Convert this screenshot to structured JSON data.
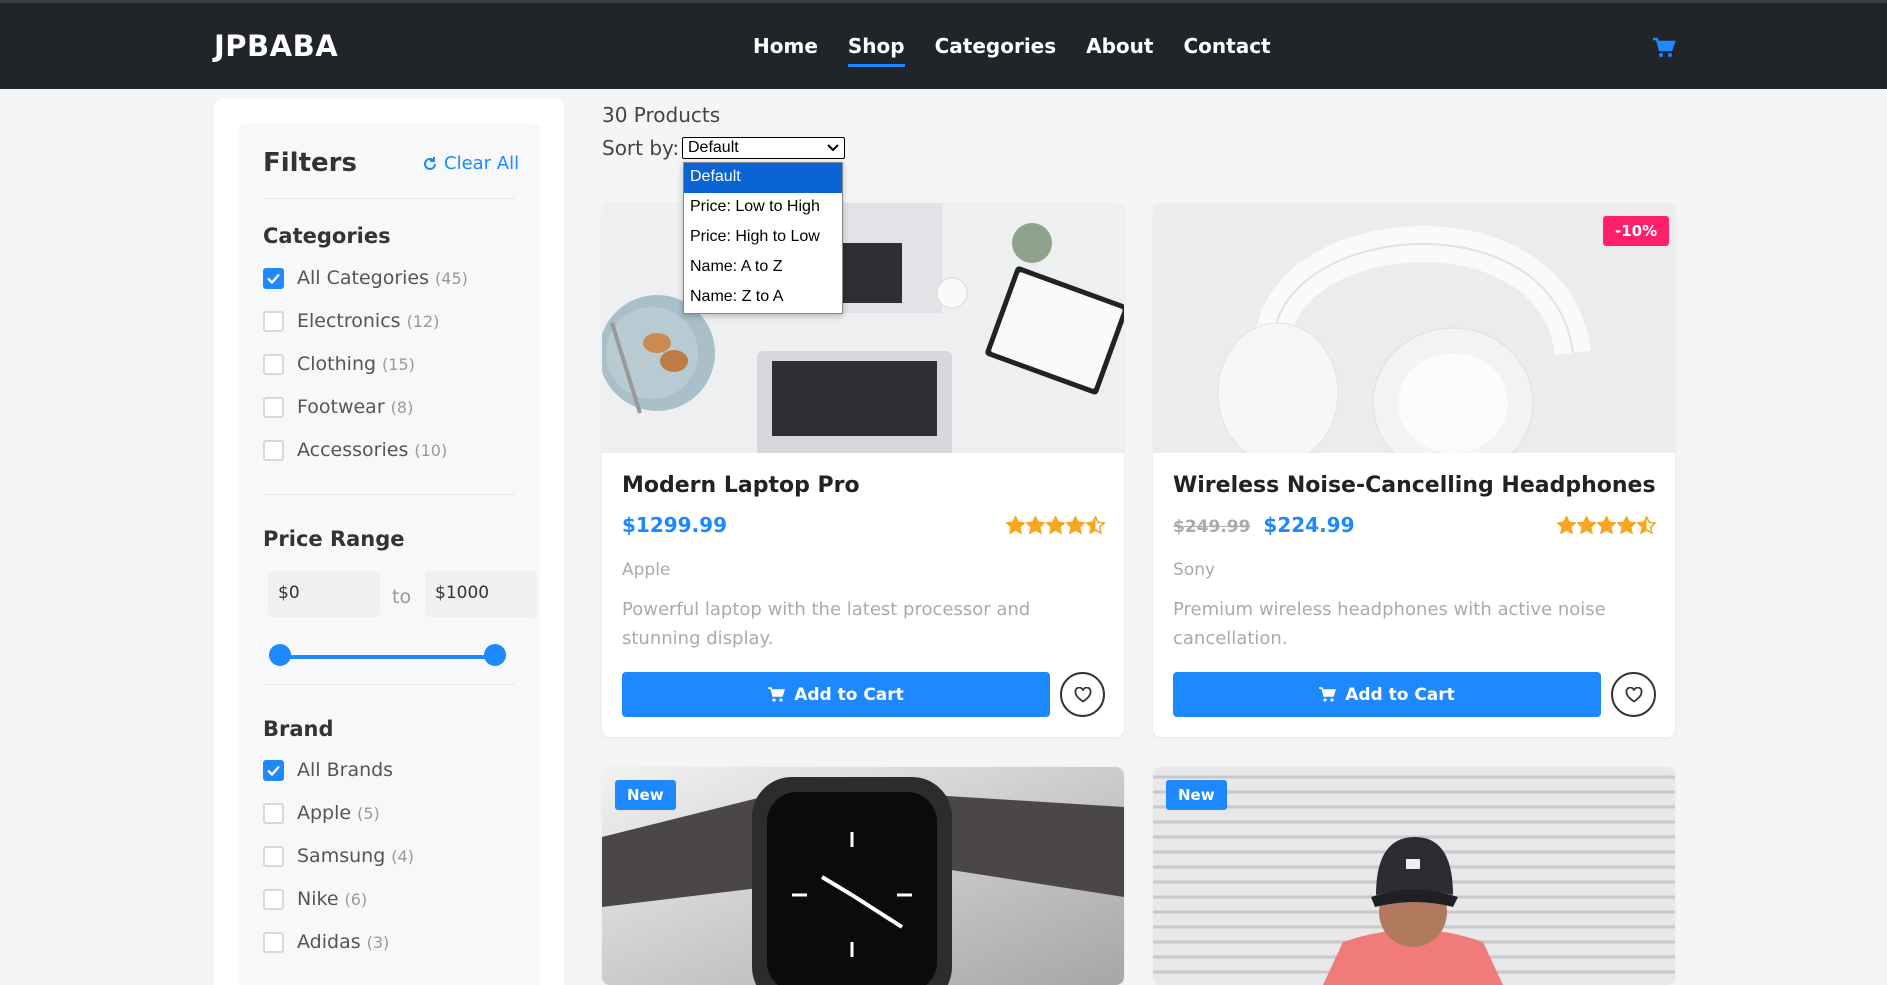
{
  "navbar": {
    "brand": "JPBABA",
    "links": [
      "Home",
      "Shop",
      "Categories",
      "About",
      "Contact"
    ],
    "active": "Shop",
    "cart_icon": "cart-icon"
  },
  "filters": {
    "title": "Filters",
    "clear_all": "Clear All",
    "categories": {
      "title": "Categories",
      "items": [
        {
          "label": "All Categories",
          "count": "(45)",
          "checked": true
        },
        {
          "label": "Electronics",
          "count": "(12)",
          "checked": false
        },
        {
          "label": "Clothing",
          "count": "(15)",
          "checked": false
        },
        {
          "label": "Footwear",
          "count": "(8)",
          "checked": false
        },
        {
          "label": "Accessories",
          "count": "(10)",
          "checked": false
        }
      ]
    },
    "price": {
      "title": "Price Range",
      "min": "$0",
      "max": "$1000",
      "to": "to"
    },
    "brand": {
      "title": "Brand",
      "items": [
        {
          "label": "All Brands",
          "count": "",
          "checked": true
        },
        {
          "label": "Apple",
          "count": "(5)",
          "checked": false
        },
        {
          "label": "Samsung",
          "count": "(4)",
          "checked": false
        },
        {
          "label": "Nike",
          "count": "(6)",
          "checked": false
        },
        {
          "label": "Adidas",
          "count": "(3)",
          "checked": false
        }
      ]
    }
  },
  "main": {
    "products_count": "30 Products",
    "sort_label": "Sort by:",
    "sort_value": "Default",
    "sort_options": [
      "Default",
      "Price: Low to High",
      "Price: High to Low",
      "Name: A to Z",
      "Name: Z to A"
    ]
  },
  "products": [
    {
      "title": "Modern Laptop Pro",
      "price": "$1299.99",
      "old_price": "",
      "rating": 4.5,
      "brand": "Apple",
      "description": "Powerful laptop with the latest processor and stunning display.",
      "button": "Add to Cart",
      "badge": ""
    },
    {
      "title": "Wireless Noise-Cancelling Headphones",
      "price": "$224.99",
      "old_price": "$249.99",
      "rating": 4.5,
      "brand": "Sony",
      "description": "Premium wireless headphones with active noise cancellation.",
      "button": "Add to Cart",
      "badge": "-10%"
    },
    {
      "badge": "New"
    },
    {
      "badge": "New"
    }
  ],
  "colors": {
    "accent": "#1e88ff",
    "navbar": "#212529",
    "sale_badge": "#ff1f6b",
    "star": "#f5a623"
  }
}
